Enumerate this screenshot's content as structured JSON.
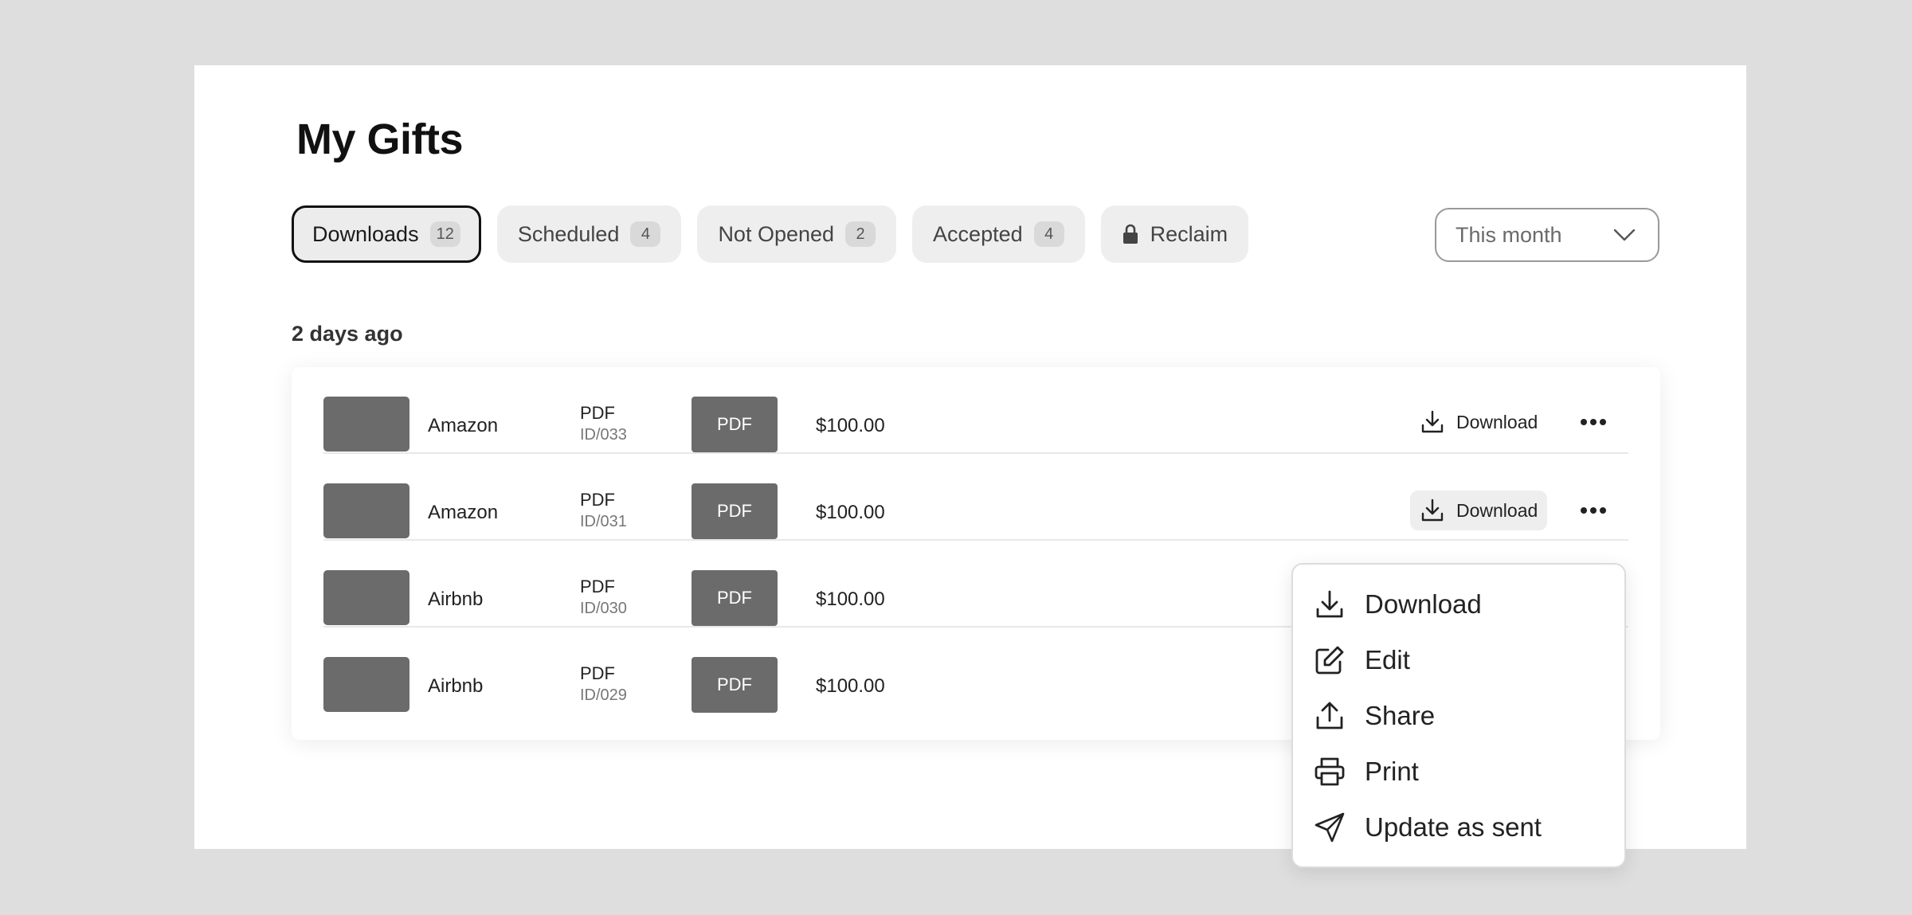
{
  "page": {
    "title": "My Gifts"
  },
  "tabs": [
    {
      "label": "Downloads",
      "count": "12",
      "active": true
    },
    {
      "label": "Scheduled",
      "count": "4"
    },
    {
      "label": "Not Opened",
      "count": "2"
    },
    {
      "label": "Accepted",
      "count": "4"
    },
    {
      "label": "Reclaim",
      "icon": "lock-icon"
    }
  ],
  "filter": {
    "value": "This month",
    "icon": "chevron-down-icon"
  },
  "section": {
    "label": "2 days ago"
  },
  "rows": [
    {
      "brand": "Amazon",
      "type": "PDF",
      "id": "ID/033",
      "tile": "PDF",
      "amount": "$100.00",
      "download": "Download"
    },
    {
      "brand": "Amazon",
      "type": "PDF",
      "id": "ID/031",
      "tile": "PDF",
      "amount": "$100.00",
      "download": "Download"
    },
    {
      "brand": "Airbnb",
      "type": "PDF",
      "id": "ID/030",
      "tile": "PDF",
      "amount": "$100.00"
    },
    {
      "brand": "Airbnb",
      "type": "PDF",
      "id": "ID/029",
      "tile": "PDF",
      "amount": "$100.00"
    }
  ],
  "menu": {
    "items": [
      {
        "label": "Download",
        "icon": "download-icon"
      },
      {
        "label": "Edit",
        "icon": "edit-icon"
      },
      {
        "label": "Share",
        "icon": "share-icon"
      },
      {
        "label": "Print",
        "icon": "printer-icon"
      },
      {
        "label": "Update as sent",
        "icon": "send-icon"
      }
    ]
  }
}
